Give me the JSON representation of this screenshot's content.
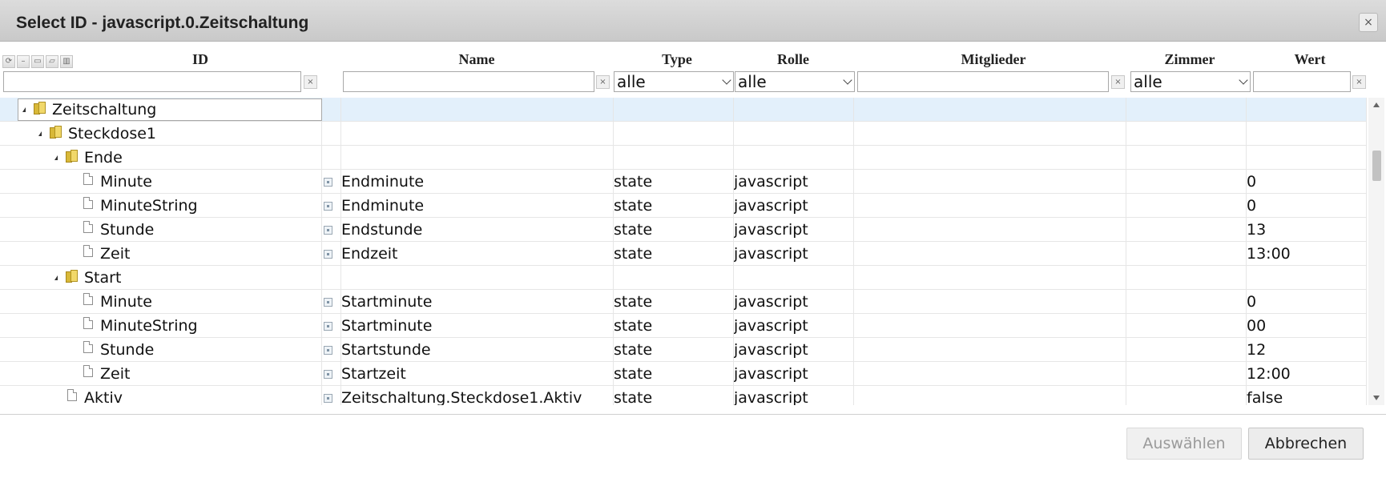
{
  "dialog": {
    "title": "Select ID - javascript.0.Zeitschaltung",
    "close_label": "×"
  },
  "toolbar": {
    "icons": [
      "refresh-icon",
      "collapse-icon",
      "folder-closed-icon",
      "folder-open-icon",
      "columns-icon"
    ]
  },
  "columns": {
    "id": "ID",
    "name": "Name",
    "type": "Type",
    "role": "Rolle",
    "members": "Mitglieder",
    "room": "Zimmer",
    "value": "Wert"
  },
  "filters": {
    "id_value": "",
    "name_value": "",
    "members_value": "",
    "value_value": "",
    "type_selected": "alle",
    "role_selected": "alle",
    "room_selected": "alle",
    "clear_label": "×"
  },
  "rows": [
    {
      "id": "Zeitschaltung",
      "kind": "folder",
      "level": 0,
      "expanded": true,
      "selected": true,
      "name": "",
      "type": "",
      "role": "",
      "value": ""
    },
    {
      "id": "Steckdose1",
      "kind": "folder",
      "level": 1,
      "expanded": true,
      "name": "",
      "type": "",
      "role": "",
      "value": ""
    },
    {
      "id": "Ende",
      "kind": "folder",
      "level": 2,
      "expanded": true,
      "name": "",
      "type": "",
      "role": "",
      "value": ""
    },
    {
      "id": "Minute",
      "kind": "state",
      "level": 3,
      "name": "Endminute",
      "type": "state",
      "role": "javascript",
      "value": "0"
    },
    {
      "id": "MinuteString",
      "kind": "state",
      "level": 3,
      "name": "Endminute",
      "type": "state",
      "role": "javascript",
      "value": "0"
    },
    {
      "id": "Stunde",
      "kind": "state",
      "level": 3,
      "name": "Endstunde",
      "type": "state",
      "role": "javascript",
      "value": "13"
    },
    {
      "id": "Zeit",
      "kind": "state",
      "level": 3,
      "name": "Endzeit",
      "type": "state",
      "role": "javascript",
      "value": "13:00"
    },
    {
      "id": "Start",
      "kind": "folder",
      "level": 2,
      "expanded": true,
      "name": "",
      "type": "",
      "role": "",
      "value": ""
    },
    {
      "id": "Minute",
      "kind": "state",
      "level": 3,
      "name": "Startminute",
      "type": "state",
      "role": "javascript",
      "value": "0"
    },
    {
      "id": "MinuteString",
      "kind": "state",
      "level": 3,
      "name": "Startminute",
      "type": "state",
      "role": "javascript",
      "value": "00"
    },
    {
      "id": "Stunde",
      "kind": "state",
      "level": 3,
      "name": "Startstunde",
      "type": "state",
      "role": "javascript",
      "value": "12"
    },
    {
      "id": "Zeit",
      "kind": "state",
      "level": 3,
      "name": "Startzeit",
      "type": "state",
      "role": "javascript",
      "value": "12:00"
    },
    {
      "id": "Aktiv",
      "kind": "state",
      "level": 2,
      "name": "Zeitschaltung.Steckdose1.Aktiv",
      "type": "state",
      "role": "javascript",
      "value": "false"
    }
  ],
  "buttons": {
    "select": "Auswählen",
    "cancel": "Abbrechen"
  },
  "colors": {
    "selected_row": "#e3f0fb",
    "titlebar": "#d2d2d2"
  }
}
